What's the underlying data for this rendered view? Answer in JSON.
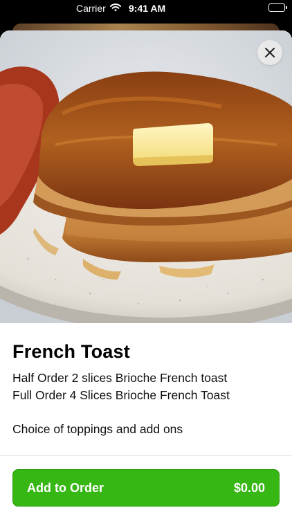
{
  "status_bar": {
    "carrier": "Carrier",
    "time": "9:41 AM",
    "wifi_icon": "wifi-icon",
    "battery_icon": "battery-icon"
  },
  "item": {
    "image_description_icon": "food-photo",
    "title": "French Toast",
    "description_lines": [
      "Half Order 2 slices Brioche French toast",
      "Full Order 4 Slices Brioche French Toast",
      "Choice of toppings and add ons"
    ]
  },
  "close_icon": "close-icon",
  "add_to_order": {
    "label": "Add to Order",
    "price": "$0.00"
  },
  "colors": {
    "accent": "#36b714",
    "text": "#000000",
    "sheet": "#ffffff"
  }
}
